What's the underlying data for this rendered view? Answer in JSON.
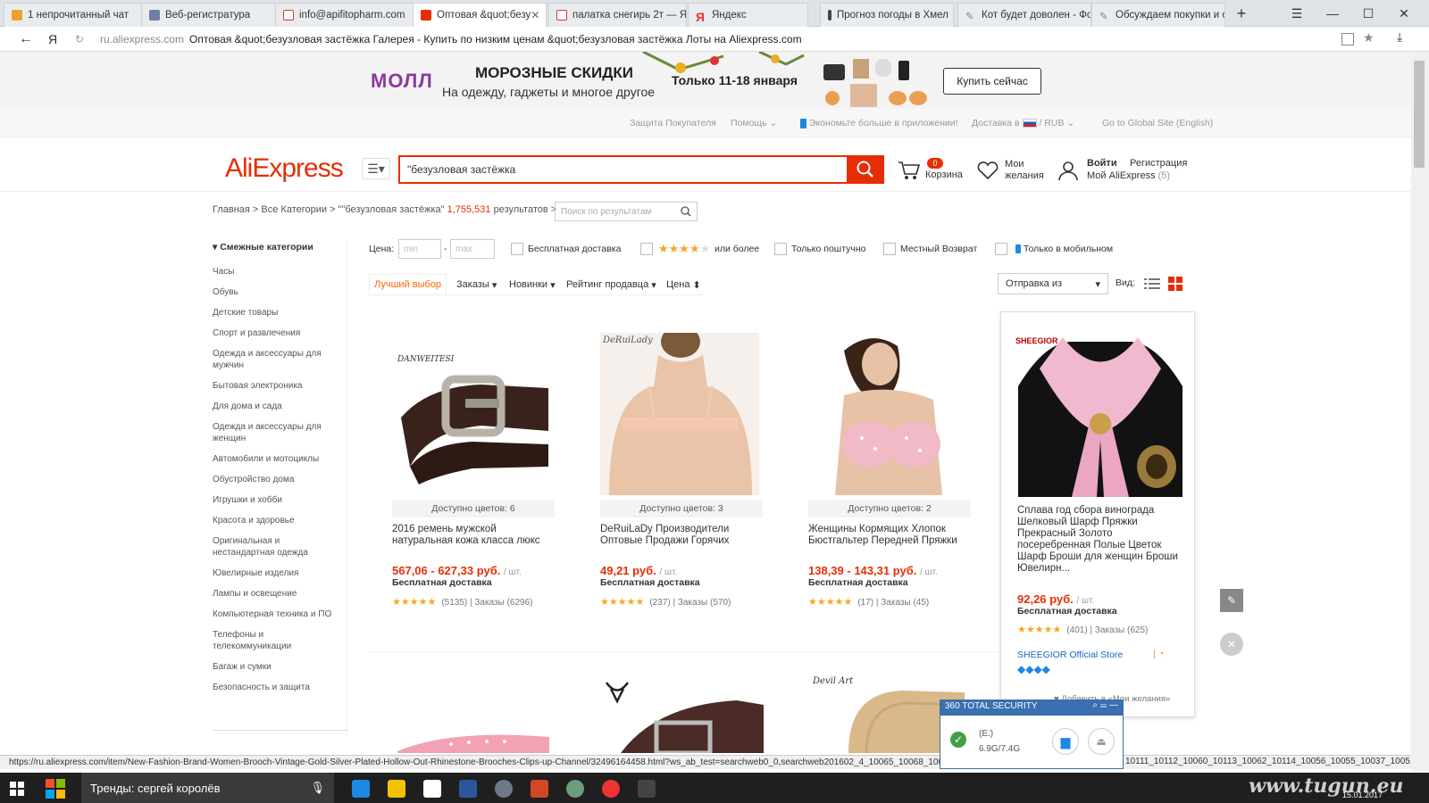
{
  "browser": {
    "tabs": [
      {
        "label": "1 непрочитанный чат",
        "color": "#f0a030"
      },
      {
        "label": "Веб-регистратура",
        "color": "#6b7fa8"
      },
      {
        "label": "info@apifitopharm.com",
        "color": "#d33"
      },
      {
        "label": "Оптовая &quot;безу",
        "color": "#e62e04"
      },
      {
        "label": "палатка снегирь 2т — Я",
        "color": "#d33"
      },
      {
        "label": "Яндекс",
        "color": "#e33"
      },
      {
        "label": "Прогноз погоды в Хмел",
        "color": "#444"
      },
      {
        "label": "Кот будет доволен - Фо",
        "color": "#888"
      },
      {
        "label": "Обсуждаем покупки и с",
        "color": "#888"
      }
    ],
    "new_tab": "+",
    "url": "ru.aliexpress.com",
    "page_title": "Оптовая &quot;безузловая застёжка Галерея - Купить по низким ценам &quot;безузловая застёжка Лоты на Aliexpress.com",
    "back": "←",
    "yandex": "Я"
  },
  "promo": {
    "mall": "МОЛЛ",
    "title": "МОРОЗНЫЕ СКИДКИ",
    "subtitle": "На одежду, гаджеты и многое другое",
    "dates": "Только 11-18 января",
    "button": "Купить сейчас"
  },
  "toplinks": {
    "protection": "Защита Покупателя",
    "help": "Помощь",
    "app": "Экономьте больше в приложении!",
    "delivery": "Доставка в",
    "currency": "/ RUB",
    "global": "Go to Global Site (English)"
  },
  "header": {
    "logo": "AliExpress",
    "search_value": "\"безузловая застёжка",
    "cart_count": "0",
    "cart_label": "Корзина",
    "wish_line1": "Мои",
    "wish_line2": "желания",
    "login": "Войти",
    "register": "Регистрация",
    "my_ali": "Мой AliExpress",
    "my_ali_count": "(5)"
  },
  "breadcrumb": {
    "path": "Главная > Все Категории > \"\"безузловая застёжка\"",
    "count": "1,755,531",
    "results": "результатов >",
    "search_placeholder": "Поиск по результатам"
  },
  "sidebar": {
    "title": "Смежные категории",
    "items": [
      "Часы",
      "Обувь",
      "Детские товары",
      "Спорт и развлечения",
      "Одежда и аксессуары для мужчин",
      "Бытовая электроника",
      "Для дома и сада",
      "Одежда и аксессуары для женщин",
      "Автомобили и мотоциклы",
      "Обустройство дома",
      "Игрушки и хобби",
      "Красота и здоровье",
      "Оригинальная и нестандартная одежда",
      "Ювелирные изделия",
      "Лампы и освещение",
      "Компьютерная техника и ПО",
      "Телефоны и телекоммуникации",
      "Багаж и сумки",
      "Безопасность и защита"
    ]
  },
  "filters": {
    "price_label": "Цена:",
    "min_placeholder": "min",
    "max_placeholder": "max",
    "dash": "-",
    "free_shipping": "Бесплатная доставка",
    "rating_more": "или более",
    "single": "Только поштучно",
    "local_return": "Местный Возврат",
    "mobile_only": "Только в мобильном"
  },
  "sort": {
    "best": "Лучший выбор",
    "orders": "Заказы",
    "new": "Новинки",
    "seller_rating": "Рейтинг продавца",
    "price": "Цена",
    "ship_from": "Отправка из",
    "view": "Вид:"
  },
  "products": [
    {
      "brand": "DANWEITESI",
      "colors": "Доступно цветов: 6",
      "title": "2016 ремень мужской натуральная кожа класса люкс",
      "price": "567,06 - 627,33 руб.",
      "unit": "/ шт.",
      "shipping": "Бесплатная доставка",
      "reviews": "(5135)",
      "orders": "Заказы (6296)"
    },
    {
      "brand": "DeRuiLady",
      "colors": "Доступно цветов: 3",
      "title": "DeRuiLaDy Производители Оптовые Продажи Горячих",
      "price": "49,21 руб.",
      "unit": "/ шт.",
      "shipping": "Бесплатная доставка",
      "reviews": "(237)",
      "orders": "Заказы (570)"
    },
    {
      "brand": "",
      "colors": "Доступно цветов: 2",
      "title": "Женщины Кормящих Хлопок Бюстгальтер Передней Пряжки",
      "price": "138,39 - 143,31 руб.",
      "unit": "/ шт.",
      "shipping": "Бесплатная доставка",
      "reviews": "(17)",
      "orders": "Заказы (45)"
    },
    {
      "brand": "SHEEGIOR",
      "colors": "",
      "title": "Сплава год сбора винограда Шелковый Шарф Пряжки Прекрасный Золото посеребренная Полые Цветок Шарф Броши для женщин Броши Ювелирн...",
      "price": "92,26 руб.",
      "unit": "/ шт.",
      "shipping": "Бесплатная доставка",
      "reviews": "(401)",
      "orders": "Заказы (625)",
      "store": "SHEEGIOR Official Store",
      "wish": "Добавить в «Мои желания»"
    }
  ],
  "row2_brands": [
    "Devil Art"
  ],
  "status_url": "https://ru.aliexpress.com/item/New-Fashion-Brand-Women-Brooch-Vintage-Gold-Silver-Plated-Hollow-Out-Rhinestone-Brooches-Clips-up-Channel/32496164458.html?ws_ab_test=searchweb0_0,searchweb201602_4_10065_10068_10000",
  "status_tail": "10111_10112_10060_10113_10062_10114_10056_10055_10037_1005...",
  "security": {
    "title": "360 TOTAL SECURITY",
    "drive": "(E:)",
    "size": "6.9G/7.4G"
  },
  "taskbar": {
    "search": "Тренды: сергей королёв",
    "watermark": "www.tugun.eu",
    "date": "15.01.2017"
  },
  "colors": {
    "accent": "#e62e04",
    "orange": "#ff6600",
    "mall": "#8b3a9c",
    "star": "#f5a623"
  }
}
